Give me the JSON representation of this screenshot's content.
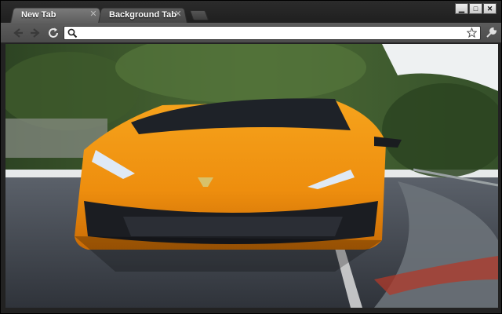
{
  "tabs": [
    {
      "label": "New Tab",
      "active": true
    },
    {
      "label": "Background Tab",
      "active": false
    }
  ],
  "window_controls": {
    "minimize_label": "▁",
    "maximize_label": "□",
    "close_label": "✕"
  },
  "tab_close_glyph": "✕",
  "toolbar": {
    "back_icon": "back-arrow-icon",
    "forward_icon": "forward-arrow-icon",
    "reload_icon": "reload-icon",
    "omnibox_value": "",
    "omnibox_placeholder": "",
    "bookmark_icon": "star-icon",
    "menu_icon": "wrench-icon"
  },
  "content": {
    "background_image": "orange sports car on race track with trees",
    "colors": {
      "car_orange": "#f29a12",
      "trees": "#3f5a2e",
      "sky": "#e8ecef",
      "road": "#3c4149"
    }
  }
}
